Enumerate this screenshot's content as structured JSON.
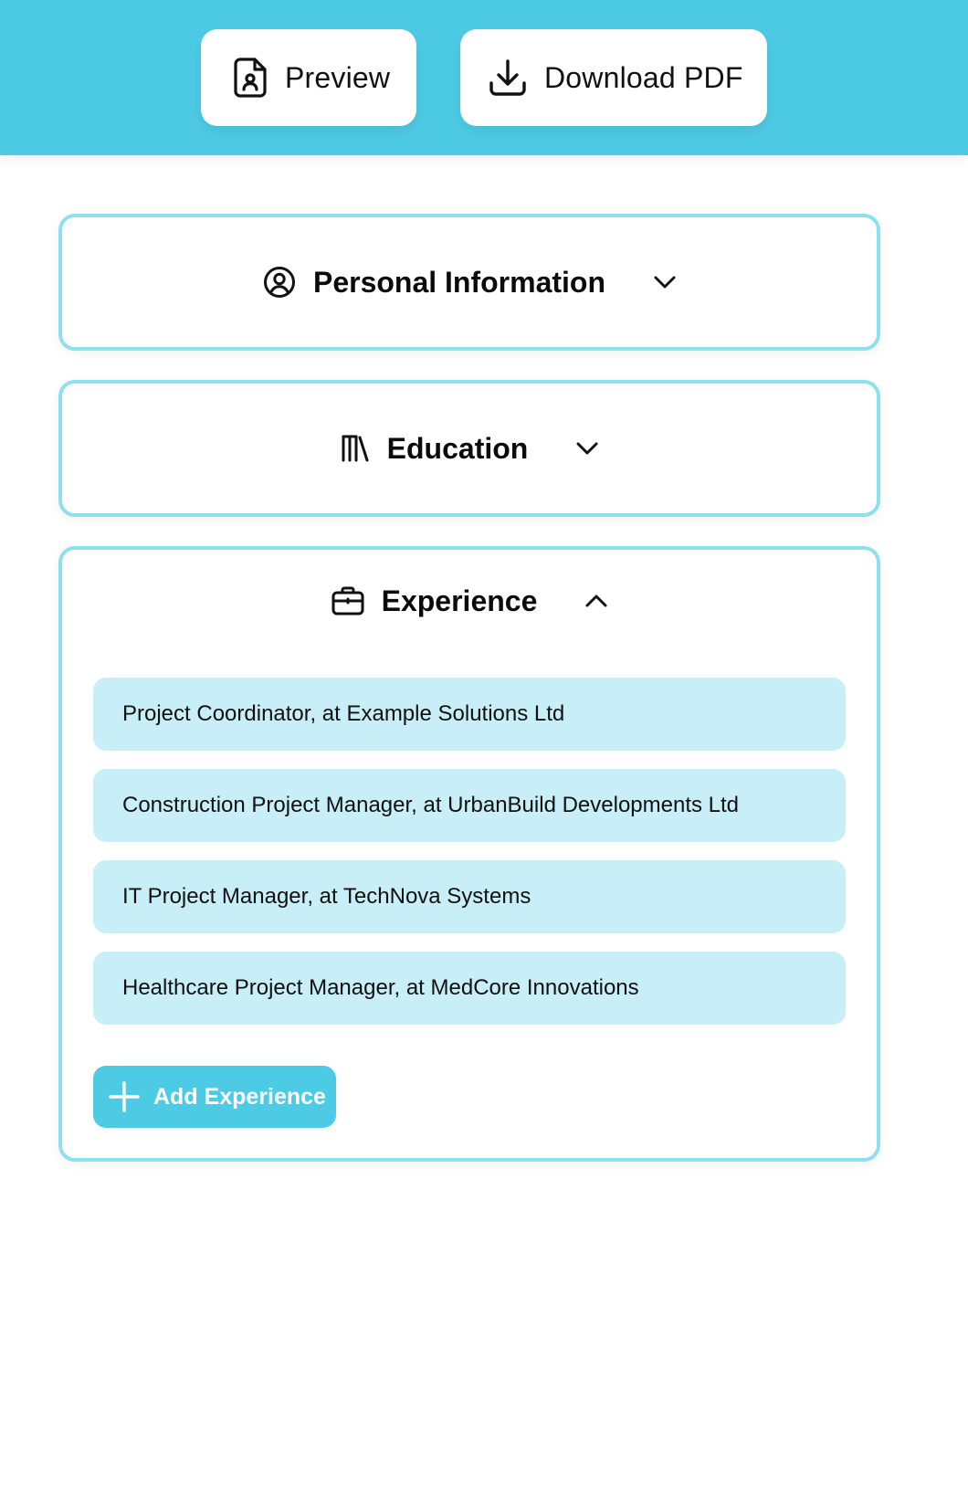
{
  "toolbar": {
    "preview_label": "Preview",
    "preview_icon": "file-user-icon",
    "download_label": "Download PDF",
    "download_icon": "download-icon"
  },
  "sections": {
    "personal": {
      "title": "Personal Information",
      "icon": "user-circle-icon",
      "state": "collapsed"
    },
    "education": {
      "title": "Education",
      "icon": "library-icon",
      "state": "collapsed"
    },
    "experience": {
      "title": "Experience",
      "icon": "briefcase-icon",
      "state": "expanded",
      "items": [
        "Project Coordinator, at Example Solutions Ltd",
        "Construction Project Manager, at UrbanBuild Developments Ltd",
        "IT Project Manager, at TechNova Systems",
        "Healthcare Project Manager, at MedCore Innovations"
      ],
      "add_label": "Add Experience"
    }
  },
  "colors": {
    "accent": "#4dcbe5",
    "border": "#8ee0ee",
    "item_bg": "#c8eef7"
  }
}
